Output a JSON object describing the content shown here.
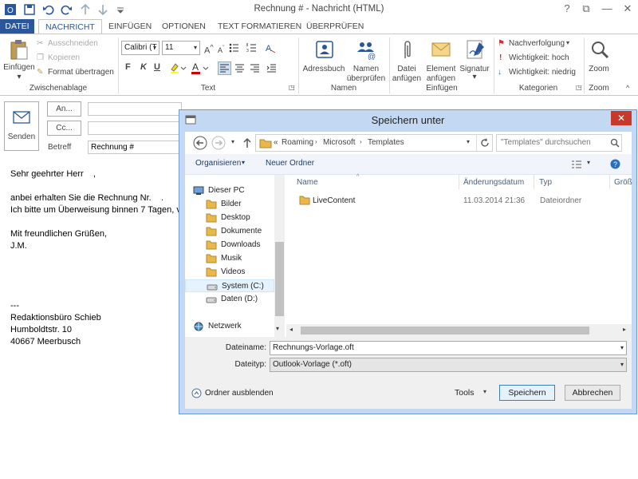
{
  "window": {
    "title": "Rechnung # - Nachricht (HTML)",
    "help": "?",
    "restore": "⧉",
    "minimize": "—",
    "close": "✕"
  },
  "tabs": [
    "DATEI",
    "NACHRICHT",
    "EINFÜGEN",
    "OPTIONEN",
    "TEXT FORMATIEREN",
    "ÜBERPRÜFEN"
  ],
  "ribbon": {
    "clipboard": {
      "paste": "Einfügen",
      "cut": "Ausschneiden",
      "copy": "Kopieren",
      "format_painter": "Format übertragen",
      "label": "Zwischenablage"
    },
    "text": {
      "font": "Calibri (T",
      "size": "11",
      "bold": "F",
      "italic": "K",
      "underline": "U",
      "label": "Text"
    },
    "names": {
      "addressbook": "Adressbuch",
      "check_names_1": "Namen",
      "check_names_2": "überprüfen",
      "label": "Namen"
    },
    "insert": {
      "attach_1": "Datei",
      "attach_2": "anfügen",
      "item_1": "Element",
      "item_2": "anfügen",
      "signature": "Signatur",
      "label": "Einfügen"
    },
    "tags": {
      "followup": "Nachverfolgung",
      "high": "Wichtigkeit: hoch",
      "low": "Wichtigkeit: niedrig",
      "label": "Kategorien"
    },
    "zoom": {
      "zoom": "Zoom",
      "label": "Zoom"
    }
  },
  "compose": {
    "send": "Senden",
    "to": "An...",
    "cc": "Cc...",
    "subject_label": "Betreff",
    "subject_value": "Rechnung #",
    "body": [
      "Sehr geehrter Herr    ,",
      "",
      "anbei erhalten Sie die Rechnung Nr.    .",
      "Ich bitte um Überweisung binnen 7 Tagen, v",
      "",
      "Mit freundlichen Grüßen,",
      "J.M.",
      "",
      "",
      "",
      "",
      "---",
      "Redaktionsbüro Schieb",
      "Humboldtstr. 10",
      "40667 Meerbusch"
    ]
  },
  "dialog": {
    "title": "Speichern unter",
    "path": [
      "Roaming",
      "Microsoft",
      "Templates"
    ],
    "path_prefix": "«",
    "search_placeholder": "\"Templates\" durchsuchen",
    "organize": "Organisieren",
    "new_folder": "Neuer Ordner",
    "nav": [
      {
        "label": "Dieser PC",
        "icon": "computer-icon"
      },
      {
        "label": "Bilder",
        "icon": "folder-icon"
      },
      {
        "label": "Desktop",
        "icon": "folder-icon"
      },
      {
        "label": "Dokumente",
        "icon": "folder-icon"
      },
      {
        "label": "Downloads",
        "icon": "folder-icon"
      },
      {
        "label": "Musik",
        "icon": "folder-icon"
      },
      {
        "label": "Videos",
        "icon": "folder-icon"
      },
      {
        "label": "System (C:)",
        "icon": "drive-icon"
      },
      {
        "label": "Daten (D:)",
        "icon": "drive-icon"
      },
      {
        "label": "Netzwerk",
        "icon": "network-icon"
      }
    ],
    "columns": [
      "Name",
      "Änderungsdatum",
      "Typ",
      "Größ"
    ],
    "files": [
      {
        "name": "LiveContent",
        "date": "11.03.2014 21:36",
        "type": "Dateiordner"
      }
    ],
    "filename_label": "Dateiname:",
    "filename_value": "Rechnungs-Vorlage.oft",
    "filetype_label": "Dateityp:",
    "filetype_value": "Outlook-Vorlage (*.oft)",
    "hide_folders": "Ordner ausblenden",
    "tools": "Tools",
    "save": "Speichern",
    "cancel": "Abbrechen"
  }
}
